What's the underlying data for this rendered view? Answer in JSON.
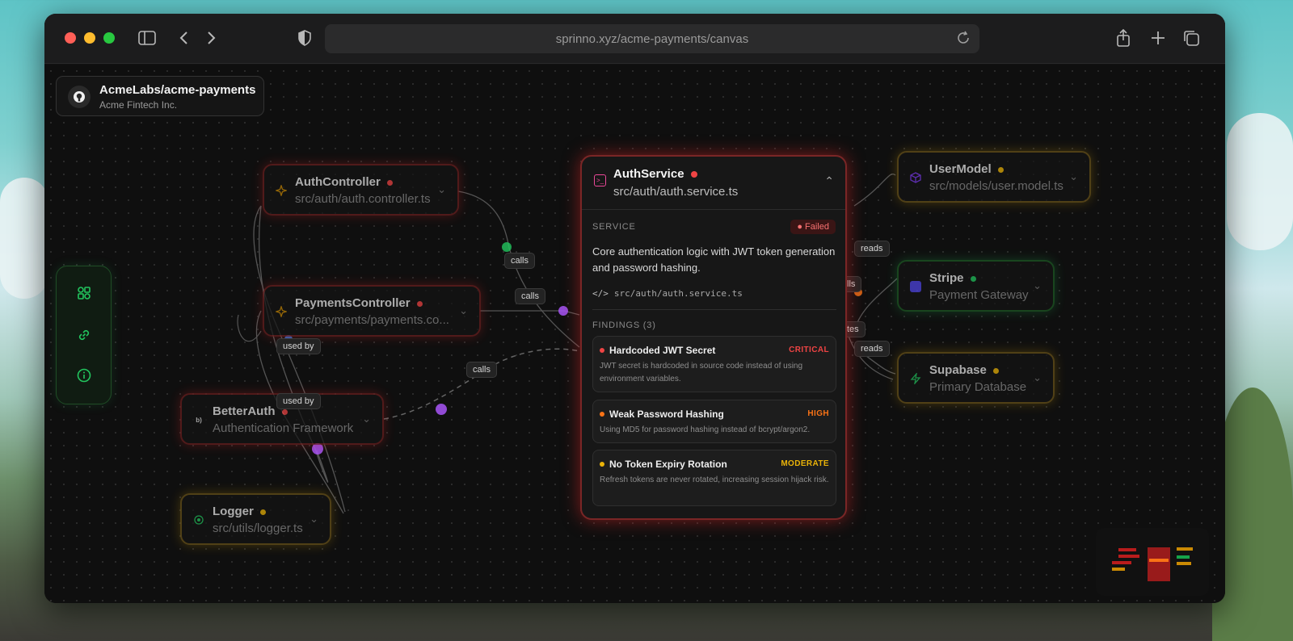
{
  "browser": {
    "url": "sprinno.xyz/acme-payments/canvas",
    "traffic_lights": [
      "#ff5f57",
      "#febc2e",
      "#28c840"
    ]
  },
  "repo": {
    "title": "AcmeLabs/acme-payments",
    "subtitle": "Acme Fintech Inc."
  },
  "toolbar": {
    "tools": [
      "nodes-icon",
      "link-icon",
      "info-icon"
    ]
  },
  "nodes": {
    "auth_controller": {
      "title": "AuthController",
      "subtitle": "src/auth/auth.controller.ts",
      "status_color": "#ef4444"
    },
    "payments_controller": {
      "title": "PaymentsController",
      "subtitle": "src/payments/payments.co...",
      "status_color": "#ef4444"
    },
    "better_auth": {
      "title": "BetterAuth",
      "subtitle": "Authentication Framework",
      "status_color": "#ef4444"
    },
    "logger": {
      "title": "Logger",
      "subtitle": "src/utils/logger.ts",
      "status_color": "#eab308"
    },
    "user_model": {
      "title": "UserModel",
      "subtitle": "src/models/user.model.ts",
      "status_color": "#eab308"
    },
    "stripe": {
      "title": "Stripe",
      "subtitle": "Payment Gateway",
      "status_color": "#22c55e"
    },
    "supabase": {
      "title": "Supabase",
      "subtitle": "Primary Database",
      "status_color": "#eab308"
    }
  },
  "edges": {
    "calls_1": "calls",
    "calls_2": "calls",
    "calls_3": "calls",
    "used_by_1": "used by",
    "used_by_2": "used by",
    "reads_1": "reads",
    "reads_2": "reads",
    "partial_calls": "lls",
    "partial_writes": "tes"
  },
  "detail": {
    "title": "AuthService",
    "subtitle": "src/auth/auth.service.ts",
    "section": "SERVICE",
    "status": "Failed",
    "description": "Core authentication logic with JWT token generation and password hashing.",
    "path": "src/auth/auth.service.ts",
    "findings_label": "FINDINGS (3)",
    "findings": [
      {
        "title": "Hardcoded JWT Secret",
        "severity": "CRITICAL",
        "color": "#ef4444",
        "description": "JWT secret is hardcoded in source code instead of using environment variables."
      },
      {
        "title": "Weak Password Hashing",
        "severity": "HIGH",
        "color": "#f97316",
        "description": "Using MD5 for password hashing instead of bcrypt/argon2."
      },
      {
        "title": "No Token Expiry Rotation",
        "severity": "MODERATE",
        "color": "#eab308",
        "description": "Refresh tokens are never rotated, increasing session hijack risk."
      }
    ]
  }
}
